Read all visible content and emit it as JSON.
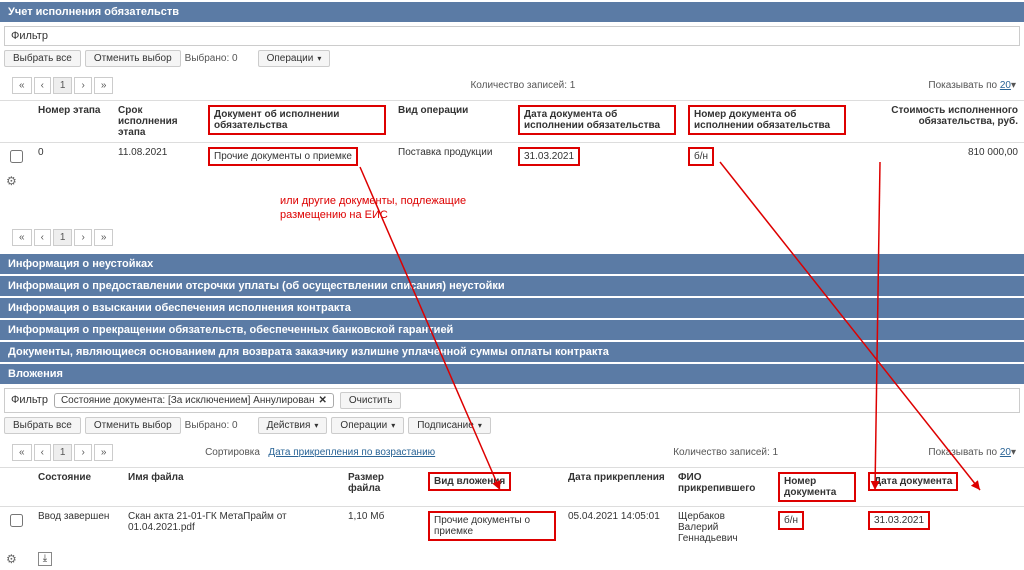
{
  "sections": {
    "obligations": "Учет исполнения обязательств",
    "penalties": "Информация о неустойках",
    "deferment": "Информация о предоставлении отсрочки уплаты (об осуществлении списания) неустойки",
    "recovery": "Информация о взыскании обеспечения исполнения контракта",
    "termination": "Информация о прекращении обязательств, обеспеченных банковской гарантией",
    "refund": "Документы, являющиеся основанием для возврата заказчику излишне уплаченной суммы оплаты контракта",
    "attachments": "Вложения"
  },
  "filter_label": "Фильтр",
  "buttons": {
    "select_all": "Выбрать все",
    "deselect": "Отменить выбор",
    "selected": "Выбрано: 0",
    "operations": "Операции",
    "actions": "Действия",
    "signing": "Подписание",
    "clear": "Очистить"
  },
  "records": {
    "count_label": "Количество записей: 1",
    "show_label": "Показывать по",
    "show_value": "20"
  },
  "pager": {
    "page": "1"
  },
  "table1": {
    "headers": {
      "stage_no": "Номер этапа",
      "stage_deadline": "Срок исполнения этапа",
      "doc_exec": "Документ об исполнении обязательства",
      "op_type": "Вид операции",
      "doc_date": "Дата документа об исполнении обязательства",
      "doc_no": "Номер документа об исполнении обязательства",
      "cost": "Стоимость исполненного обязательства, руб."
    },
    "row": {
      "stage_no": "0",
      "stage_deadline": "11.08.2021",
      "doc_exec": "Прочие документы о приемке",
      "op_type": "Поставка продукции",
      "doc_date": "31.03.2021",
      "doc_no": "б/н",
      "cost": "810 000,00"
    }
  },
  "annotation": {
    "line1": "или другие документы, подлежащие",
    "line2": "размещению на ЕИС"
  },
  "attach_filter": {
    "chip_label": "Состояние документа: [За исключением] Аннулирован"
  },
  "sort": {
    "label": "Сортировка",
    "value": "Дата прикрепления по возрастанию"
  },
  "table2": {
    "headers": {
      "state": "Состояние",
      "filename": "Имя файла",
      "filesize": "Размер файла",
      "attach_type": "Вид вложения",
      "attach_date": "Дата прикрепления",
      "attached_by": "ФИО прикрепившего",
      "doc_no": "Номер документа",
      "doc_date": "Дата документа"
    },
    "row": {
      "state": "Ввод завершен",
      "filename": "Скан акта 21-01-ГК МетаПрайм от 01.04.2021.pdf",
      "filesize": "1,10 Мб",
      "attach_type": "Прочие документы о приемке",
      "attach_date": "05.04.2021 14:05:01",
      "attached_by": "Щербаков Валерий Геннадьевич",
      "doc_no": "б/н",
      "doc_date": "31.03.2021"
    }
  }
}
